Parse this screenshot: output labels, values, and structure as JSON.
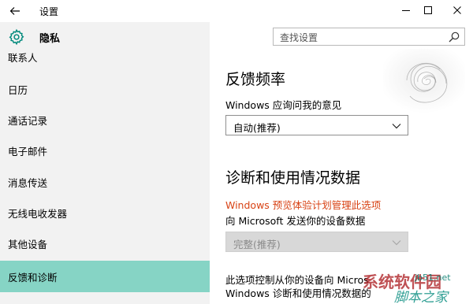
{
  "window": {
    "title": "设置"
  },
  "header": {
    "section": "隐私",
    "search_placeholder": "查找设置"
  },
  "sidebar": {
    "items": [
      {
        "label": "联系人"
      },
      {
        "label": "日历"
      },
      {
        "label": "通话记录"
      },
      {
        "label": "电子邮件"
      },
      {
        "label": "消息传送"
      },
      {
        "label": "无线电收发器"
      },
      {
        "label": "其他设备"
      },
      {
        "label": "反馈和诊断",
        "selected": true
      }
    ]
  },
  "main": {
    "feedback_heading": "反馈频率",
    "feedback_label": "Windows 应询问我的意见",
    "feedback_value": "自动(推荐)",
    "diag_heading": "诊断和使用情况数据",
    "diag_warning": "Windows 预览体验计划管理此选项",
    "diag_label": "向 Microsoft 发送你的设备数据",
    "diag_value": "完整(推荐)",
    "desc_line1": "此选项控制从你的设备向 Micros",
    "desc_line2": "Windows 诊断和使用情况数据的"
  },
  "watermark": {
    "line1": "jb51.net",
    "line2": "脚本之家",
    "brand": "系统软件园"
  },
  "colors": {
    "sidebar_bg": "#f2f2f2",
    "selected_bg": "#86d4c5",
    "accent": "#00897b",
    "warning": "#d84315"
  },
  "icons": {
    "back": "back-arrow-icon",
    "gear": "gear-icon",
    "search": "search-icon",
    "minimize": "minimize-icon",
    "maximize": "maximize-icon",
    "close": "close-icon",
    "chevron": "chevron-down-icon"
  }
}
